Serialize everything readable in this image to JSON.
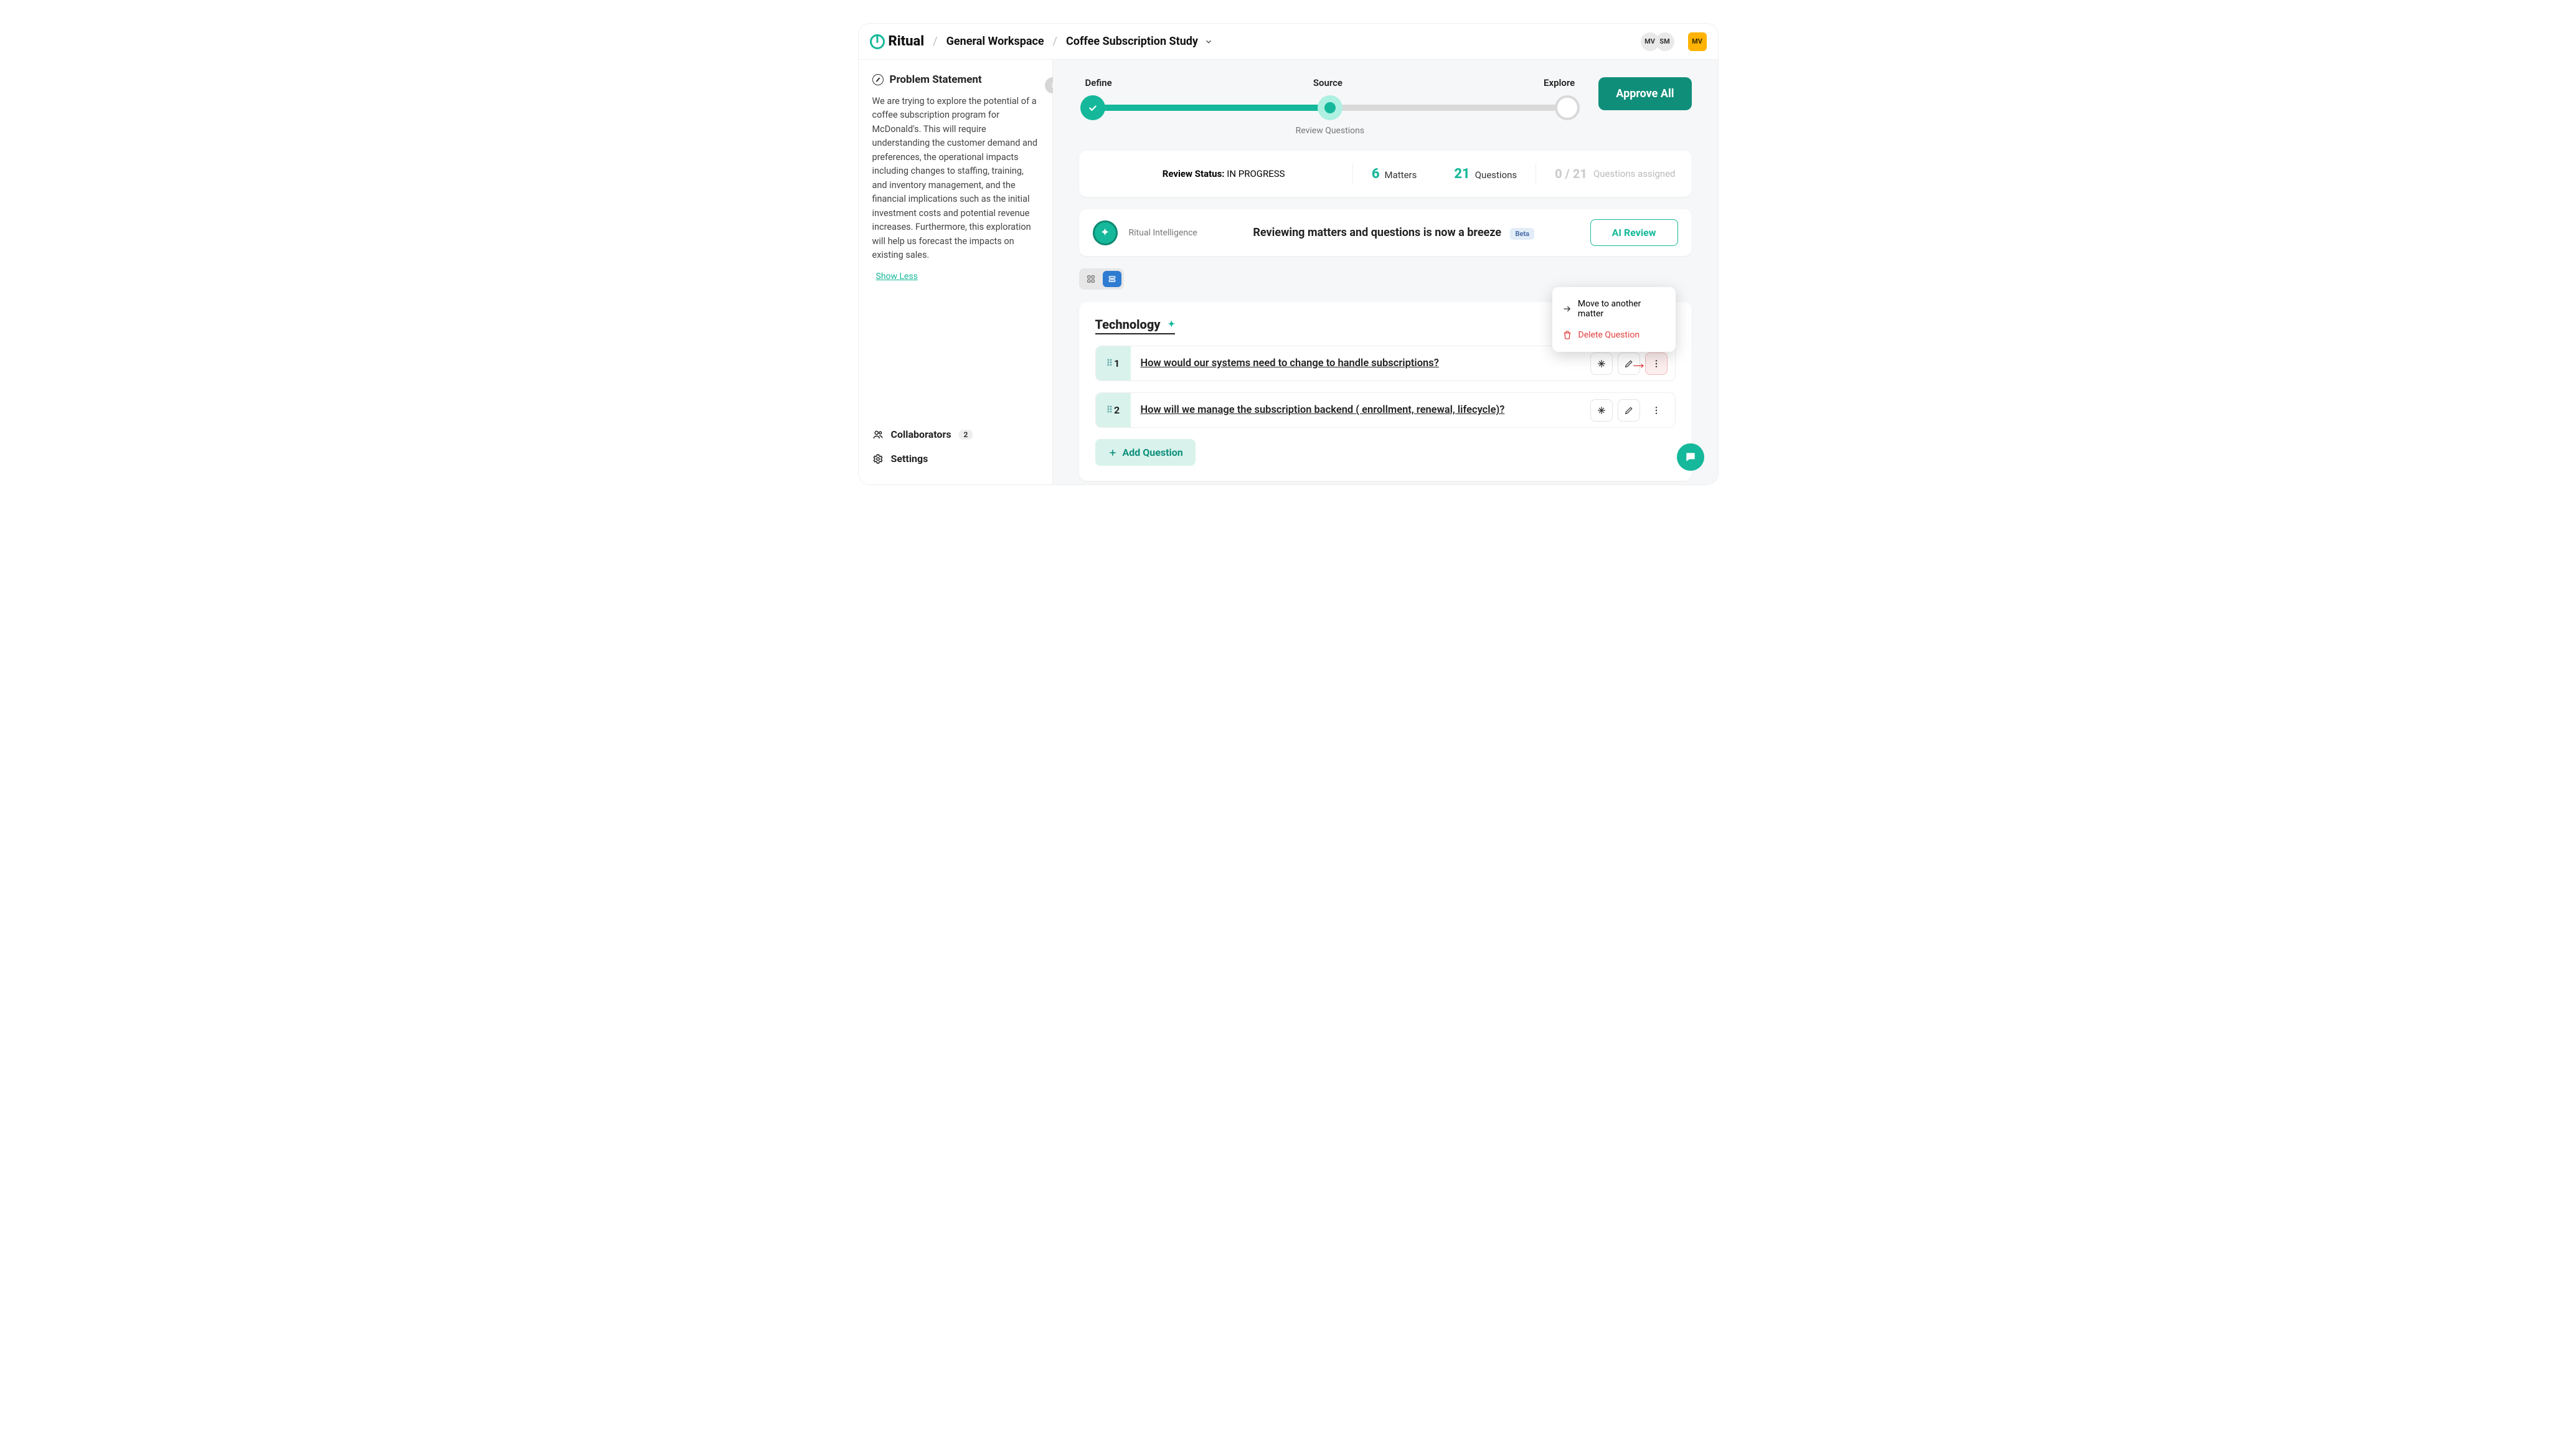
{
  "header": {
    "brand": "Ritual",
    "breadcrumbs": [
      "General Workspace",
      "Coffee Subscription Study"
    ],
    "avatars": [
      "MV",
      "SM"
    ],
    "active_user": "MV"
  },
  "sidebar": {
    "title": "Problem Statement",
    "body": "We are trying to explore the potential of a coffee subscription program for McDonald's. This will require understanding the customer demand and preferences, the operational impacts including changes to staffing, training, and inventory management, and the financial implications such as the initial investment costs and potential revenue increases. Furthermore, this exploration will help us forecast the impacts on existing sales.",
    "toggle": "Show Less",
    "collaborators_label": "Collaborators",
    "collaborators_count": "2",
    "settings_label": "Settings"
  },
  "stepper": {
    "steps": [
      "Define",
      "Source",
      "Explore"
    ],
    "substep": "Review Questions",
    "approve_label": "Approve All"
  },
  "status": {
    "label": "Review Status:",
    "value": "IN PROGRESS",
    "matters_count": "6",
    "matters_label": "Matters",
    "questions_count": "21",
    "questions_label": "Questions",
    "assigned_count": "0 / 21",
    "assigned_label": "Questions assigned"
  },
  "ai": {
    "name": "Ritual Intelligence",
    "headline": "Reviewing matters and questions is now a breeze",
    "beta": "Beta",
    "button": "AI Review"
  },
  "matter": {
    "title": "Technology",
    "questions": [
      {
        "n": "1",
        "text": "How would our systems need to change to handle subscriptions?"
      },
      {
        "n": "2",
        "text": "How will we manage the subscription backend ( enrollment, renewal, lifecycle)?"
      }
    ],
    "add_label": "Add Question"
  },
  "menu": {
    "move": "Move to another matter",
    "delete": "Delete Question"
  }
}
